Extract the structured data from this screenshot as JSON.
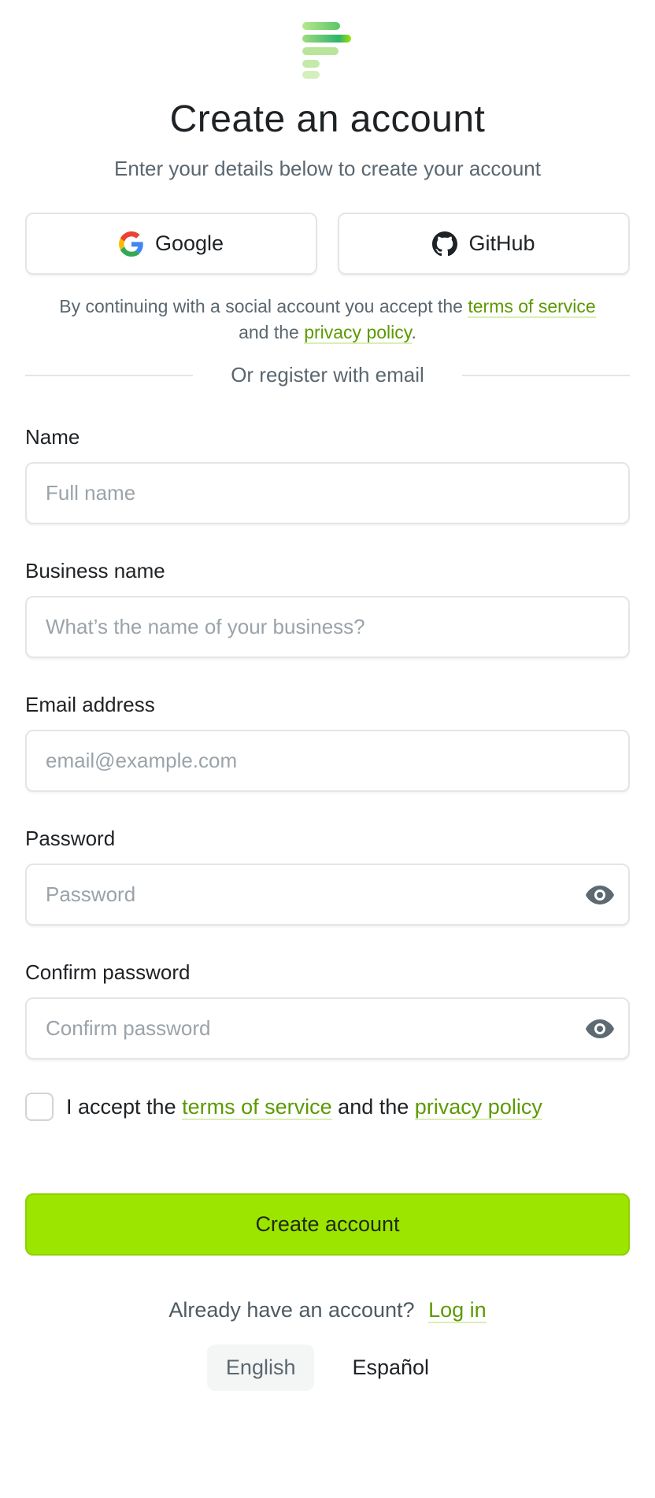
{
  "header": {
    "logo_icon": "brand-logo-icon",
    "title": "Create an account",
    "subtitle": "Enter your details below to create your account"
  },
  "social": {
    "google_label": "Google",
    "google_icon": "google-icon",
    "github_label": "GitHub",
    "github_icon": "github-icon",
    "note_prefix": "By continuing with a social account you accept the",
    "note_terms": "terms of service",
    "note_middle": "and the",
    "note_privacy": "privacy policy",
    "note_suffix": "."
  },
  "divider": {
    "text": "Or register with email"
  },
  "form": {
    "name": {
      "label": "Name",
      "placeholder": "Full name",
      "value": ""
    },
    "business": {
      "label": "Business name",
      "placeholder": "What’s the name of your business?",
      "value": ""
    },
    "email": {
      "label": "Email address",
      "placeholder": "email@example.com",
      "value": ""
    },
    "password": {
      "label": "Password",
      "placeholder": "Password",
      "value": "",
      "toggle_icon": "eye-icon"
    },
    "confirm": {
      "label": "Confirm password",
      "placeholder": "Confirm password",
      "value": "",
      "toggle_icon": "eye-icon"
    },
    "accept": {
      "checked": false,
      "prefix": "I accept the",
      "terms": "terms of service",
      "middle": "and the",
      "privacy": "privacy policy"
    },
    "submit_label": "Create account"
  },
  "footer": {
    "login_prompt": "Already have an account?",
    "login_link": "Log in",
    "languages": [
      "English",
      "Español"
    ],
    "active_language": "English"
  },
  "colors": {
    "accent": "#9be500",
    "link": "#5b9a00",
    "muted": "#5a6770"
  }
}
